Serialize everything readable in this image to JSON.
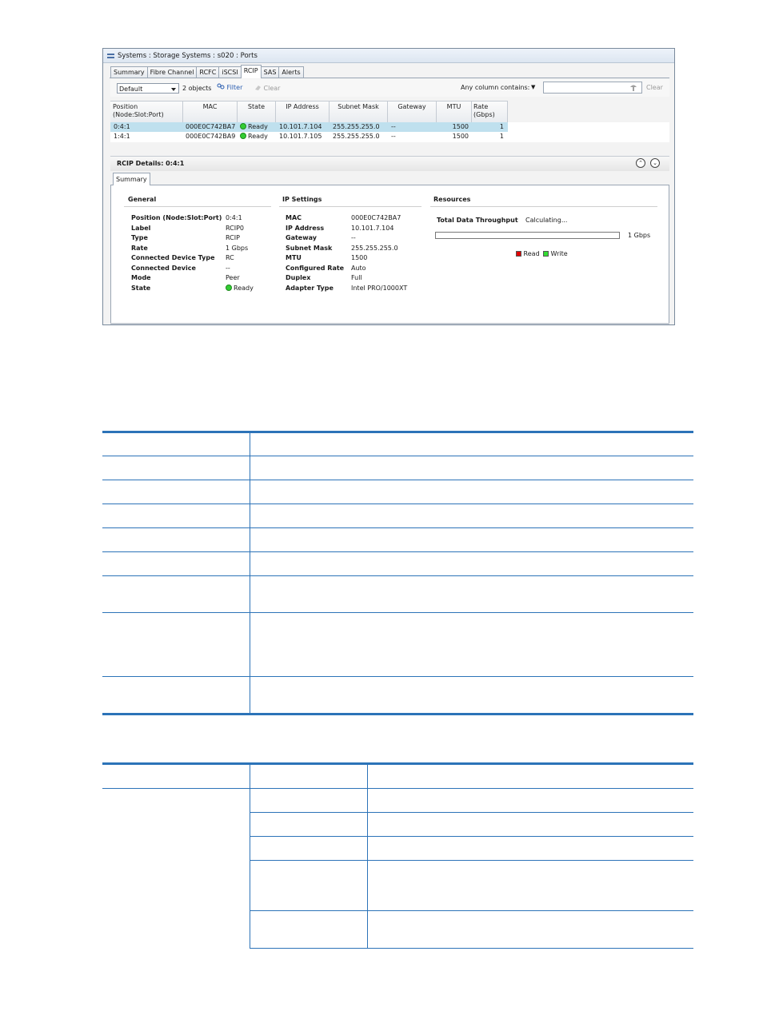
{
  "window": {
    "title": "Systems : Storage Systems : s020 : Ports",
    "tabs": [
      "Summary",
      "Fibre Channel",
      "RCFC",
      "iSCSI",
      "RCIP",
      "SAS",
      "Alerts"
    ],
    "active_tab": "RCIP"
  },
  "toolbar": {
    "view_select": "Default",
    "object_count": "2 objects",
    "filter_label": "Filter",
    "clear_label": "Clear",
    "search_label": "Any column contains:",
    "search_value": "",
    "search_clear_label": "Clear"
  },
  "grid": {
    "columns": [
      "Position\n(Node:Slot:Port)",
      "MAC",
      "State",
      "IP Address",
      "Subnet Mask",
      "Gateway",
      "MTU",
      "Rate\n(Gbps)"
    ],
    "rows": [
      {
        "position": "0:4:1",
        "mac": "000E0C742BA7",
        "state": "Ready",
        "ip": "10.101.7.104",
        "mask": "255.255.255.0",
        "gateway": "--",
        "mtu": "1500",
        "rate": "1"
      },
      {
        "position": "1:4:1",
        "mac": "000E0C742BA9",
        "state": "Ready",
        "ip": "10.101.7.105",
        "mask": "255.255.255.0",
        "gateway": "--",
        "mtu": "1500",
        "rate": "1"
      }
    ]
  },
  "details": {
    "title": "RCIP Details: 0:4:1",
    "subtab": "Summary",
    "general": {
      "heading": "General",
      "items": [
        {
          "k": "Position (Node:Slot:Port)",
          "v": "0:4:1"
        },
        {
          "k": "Label",
          "v": "RCIP0"
        },
        {
          "k": "Type",
          "v": "RCIP"
        },
        {
          "k": "Rate",
          "v": "1 Gbps"
        },
        {
          "k": "Connected Device Type",
          "v": "RC"
        },
        {
          "k": "Connected Device",
          "v": "--"
        },
        {
          "k": "Mode",
          "v": "Peer"
        },
        {
          "k": "State",
          "v": "Ready"
        }
      ]
    },
    "ip_settings": {
      "heading": "IP Settings",
      "items": [
        {
          "k": "MAC",
          "v": "000E0C742BA7"
        },
        {
          "k": "IP Address",
          "v": "10.101.7.104"
        },
        {
          "k": "Gateway",
          "v": "--"
        },
        {
          "k": "Subnet Mask",
          "v": "255.255.255.0"
        },
        {
          "k": "MTU",
          "v": "1500"
        },
        {
          "k": "Configured Rate",
          "v": "Auto"
        },
        {
          "k": "Duplex",
          "v": "Full"
        },
        {
          "k": "Adapter Type",
          "v": "Intel PRO/1000XT"
        }
      ]
    },
    "resources": {
      "heading": "Resources",
      "throughput_label": "Total Data Throughput",
      "throughput_value": "Calculating...",
      "bar_max_label": "1 Gbps",
      "bar_fill_fraction": 0,
      "legend_read": "Read",
      "legend_write": "Write",
      "read_color": "#e00000",
      "write_color": "#33dd33"
    }
  },
  "colors": {
    "selection": "#bfe0ee",
    "ready": "#33cc33",
    "table_rule": "#2c73b8"
  }
}
